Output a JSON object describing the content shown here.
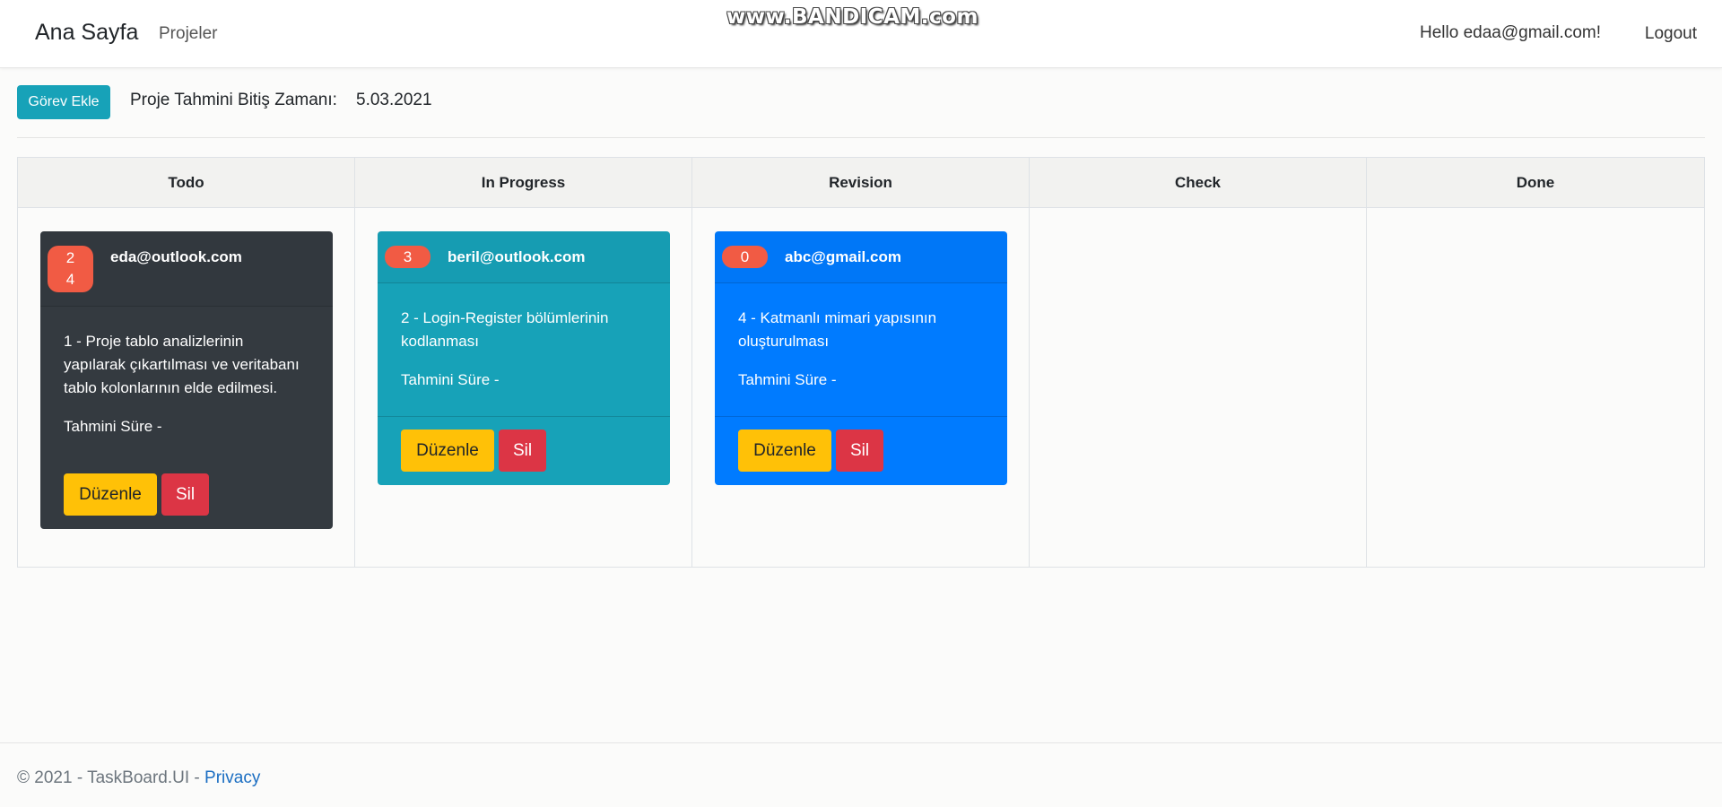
{
  "navbar": {
    "brand": "Ana Sayfa",
    "projects_link": "Projeler",
    "greeting": "Hello edaa@gmail.com!",
    "logout": "Logout"
  },
  "watermark": "www.BANDICAM.com",
  "toolbar": {
    "add_task_label": "Görev Ekle",
    "estimate_label": "Proje Tahmini Bitiş Zamanı:",
    "estimate_value": "5.03.2021"
  },
  "board": {
    "columns": [
      {
        "title": "Todo"
      },
      {
        "title": "In Progress"
      },
      {
        "title": "Revision"
      },
      {
        "title": "Check"
      },
      {
        "title": "Done"
      }
    ],
    "cards": [
      {
        "column": "Todo",
        "badge": "2 4",
        "badge_line1": "2",
        "badge_line2": "4",
        "user": "eda@outlook.com",
        "description": "1 - Proje tablo analizlerinin yapılarak çıkartılması ve veritabanı tablo kolonlarının elde edilmesi.",
        "duration": "Tahmini Süre -",
        "edit_label": "Düzenle",
        "delete_label": "Sil",
        "color": "#343a40"
      },
      {
        "column": "In Progress",
        "badge": "3",
        "user": "beril@outlook.com",
        "description": "2 - Login-Register bölümlerinin kodlanması",
        "duration": "Tahmini Süre -",
        "edit_label": "Düzenle",
        "delete_label": "Sil",
        "color": "#17a2b8"
      },
      {
        "column": "Revision",
        "badge": "0",
        "user": "abc@gmail.com",
        "description": "4 - Katmanlı mimari yapısının oluşturulması",
        "duration": "Tahmini Süre -",
        "edit_label": "Düzenle",
        "delete_label": "Sil",
        "color": "#007bff"
      }
    ]
  },
  "footer": {
    "copyright": "© 2021 - TaskBoard.UI - ",
    "privacy_link": "Privacy"
  },
  "colors": {
    "info": "#17a2b8",
    "primary": "#007bff",
    "dark": "#343a40",
    "warning": "#ffc107",
    "danger": "#dc3545",
    "badge": "#f15b44"
  }
}
